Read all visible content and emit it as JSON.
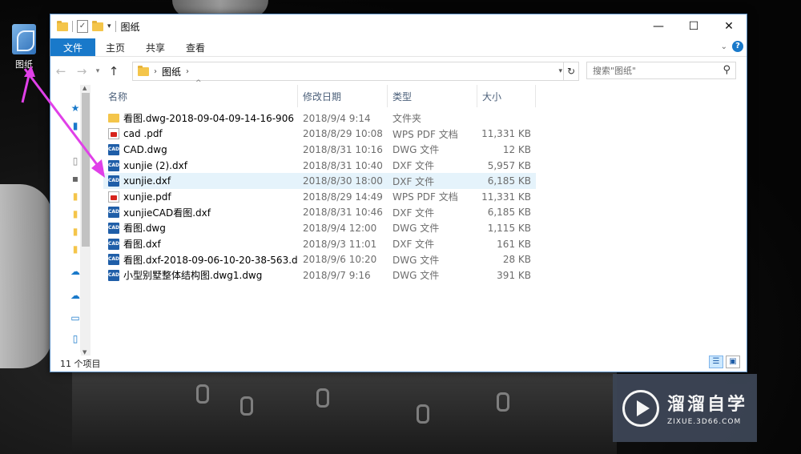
{
  "desktop": {
    "icon_label": "图纸"
  },
  "window": {
    "title": "图纸",
    "controls": {
      "minimize": "—",
      "maximize": "☐",
      "close": "✕"
    }
  },
  "ribbon": {
    "tabs": [
      "文件",
      "主页",
      "共享",
      "查看"
    ],
    "collapse": "⌄",
    "help": "?"
  },
  "address": {
    "crumb": "图纸"
  },
  "search": {
    "placeholder": "搜索\"图纸\""
  },
  "columns": [
    "名称",
    "修改日期",
    "类型",
    "大小"
  ],
  "files": [
    {
      "name": "看图.dwg-2018-09-04-09-14-16-906",
      "date": "2018/9/4 9:14",
      "type": "文件夹",
      "size": "",
      "icon": "folder"
    },
    {
      "name": "cad .pdf",
      "date": "2018/8/29 10:08",
      "type": "WPS PDF 文档",
      "size": "11,331 KB",
      "icon": "pdf"
    },
    {
      "name": "CAD.dwg",
      "date": "2018/8/31 10:16",
      "type": "DWG 文件",
      "size": "12 KB",
      "icon": "cad"
    },
    {
      "name": "xunjie (2).dxf",
      "date": "2018/8/31 10:40",
      "type": "DXF 文件",
      "size": "5,957 KB",
      "icon": "cad"
    },
    {
      "name": "xunjie.dxf",
      "date": "2018/8/30 18:00",
      "type": "DXF 文件",
      "size": "6,185 KB",
      "icon": "cad",
      "selected": true
    },
    {
      "name": "xunjie.pdf",
      "date": "2018/8/29 14:49",
      "type": "WPS PDF 文档",
      "size": "11,331 KB",
      "icon": "pdf"
    },
    {
      "name": "xunjieCAD看图.dxf",
      "date": "2018/8/31 10:46",
      "type": "DXF 文件",
      "size": "6,185 KB",
      "icon": "cad"
    },
    {
      "name": "看图.dwg",
      "date": "2018/9/4 12:00",
      "type": "DWG 文件",
      "size": "1,115 KB",
      "icon": "cad"
    },
    {
      "name": "看图.dxf",
      "date": "2018/9/3 11:01",
      "type": "DXF 文件",
      "size": "161 KB",
      "icon": "cad"
    },
    {
      "name": "看图.dxf-2018-09-06-10-20-38-563.d",
      "date": "2018/9/6 10:20",
      "type": "DWG 文件",
      "size": "28 KB",
      "icon": "cad"
    },
    {
      "name": "小型别墅整体结构图.dwg1.dwg",
      "date": "2018/9/7 9:16",
      "type": "DWG 文件",
      "size": "391 KB",
      "icon": "cad"
    }
  ],
  "status": {
    "count_label": "11 个项目"
  },
  "watermark": {
    "name": "溜溜自学",
    "url": "ZIXUE.3D66.COM"
  },
  "colors": {
    "accent": "#1979ca",
    "arrow": "#e040e8",
    "selection": "#e5f3fb"
  }
}
